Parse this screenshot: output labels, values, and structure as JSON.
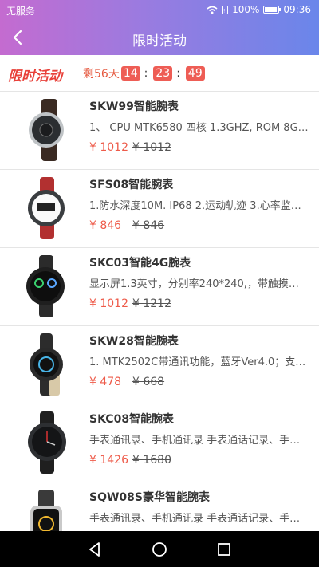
{
  "status": {
    "carrier": "无服务",
    "battery": "100%",
    "time": "09:36",
    "battery_level": 1.0
  },
  "header": {
    "title": "限时活动"
  },
  "flash_sale": {
    "logo_text": "限时活动",
    "remaining_label": "剩56天",
    "hours": "14",
    "minutes": "23",
    "seconds": "49",
    "separator": ":"
  },
  "products": [
    {
      "name": "SKW99智能腕表",
      "desc": "1、 CPU MTK6580  四核  1.3GHZ, ROM 8G…",
      "price": "¥ 1012",
      "original_price": "¥ 1012"
    },
    {
      "name": "SFS08智能腕表",
      "desc": "1.防水深度10M.   IP68 2.运动轨迹 3.心率监…",
      "price": "¥ 846",
      "original_price": "¥ 846"
    },
    {
      "name": "SKC03智能4G腕表",
      "desc": "显示屏1.3英寸，分别率240*240,，带触摸…",
      "price": "¥ 1012",
      "original_price": "¥ 1212"
    },
    {
      "name": "SKW28智能腕表",
      "desc": "1. MTK2502C带通讯功能，蓝牙Ver4.0；支…",
      "price": "¥ 478",
      "original_price": "¥ 668"
    },
    {
      "name": "SKC08智能腕表",
      "desc": "手表通讯录、手机通讯录 手表通话记录、手…",
      "price": "¥ 1426",
      "original_price": "¥ 1680"
    },
    {
      "name": "SQW08S豪华智能腕表",
      "desc": "手表通讯录、手机通讯录 手表通话记录、手…",
      "price": "",
      "original_price": ""
    }
  ],
  "icons": {
    "back": "chevron-left-icon",
    "wifi": "wifi-icon",
    "nav_back": "triangle-back-icon",
    "nav_home": "circle-home-icon",
    "nav_recent": "square-recent-icon"
  }
}
